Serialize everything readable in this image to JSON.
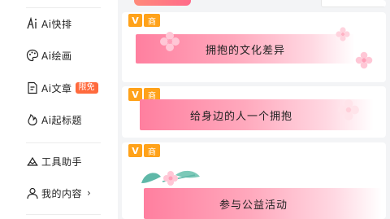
{
  "sidebar": {
    "items": [
      {
        "label": "Ai快排",
        "icon": "ai-typeset-icon"
      },
      {
        "label": "Ai绘画",
        "icon": "palette-icon"
      },
      {
        "label": "Ai文章",
        "icon": "article-icon",
        "badge": "限免"
      },
      {
        "label": "Ai起标题",
        "icon": "flame-icon"
      },
      {
        "label": "工具助手",
        "icon": "tools-icon"
      },
      {
        "label": "我的内容",
        "icon": "user-icon",
        "chevron": "›"
      }
    ]
  },
  "cards": [
    {
      "title": "拥抱的文化差异",
      "tag_v": "V",
      "tag_s": "商"
    },
    {
      "title": "给身边的人一个拥抱",
      "tag_v": "V",
      "tag_s": "商"
    },
    {
      "title": "参与公益活动",
      "tag_v": "V",
      "tag_s": "商"
    }
  ],
  "colors": {
    "badge": "#ff6a3d",
    "tag": "#ffa21a",
    "banner_start": "#ff7f9f"
  }
}
